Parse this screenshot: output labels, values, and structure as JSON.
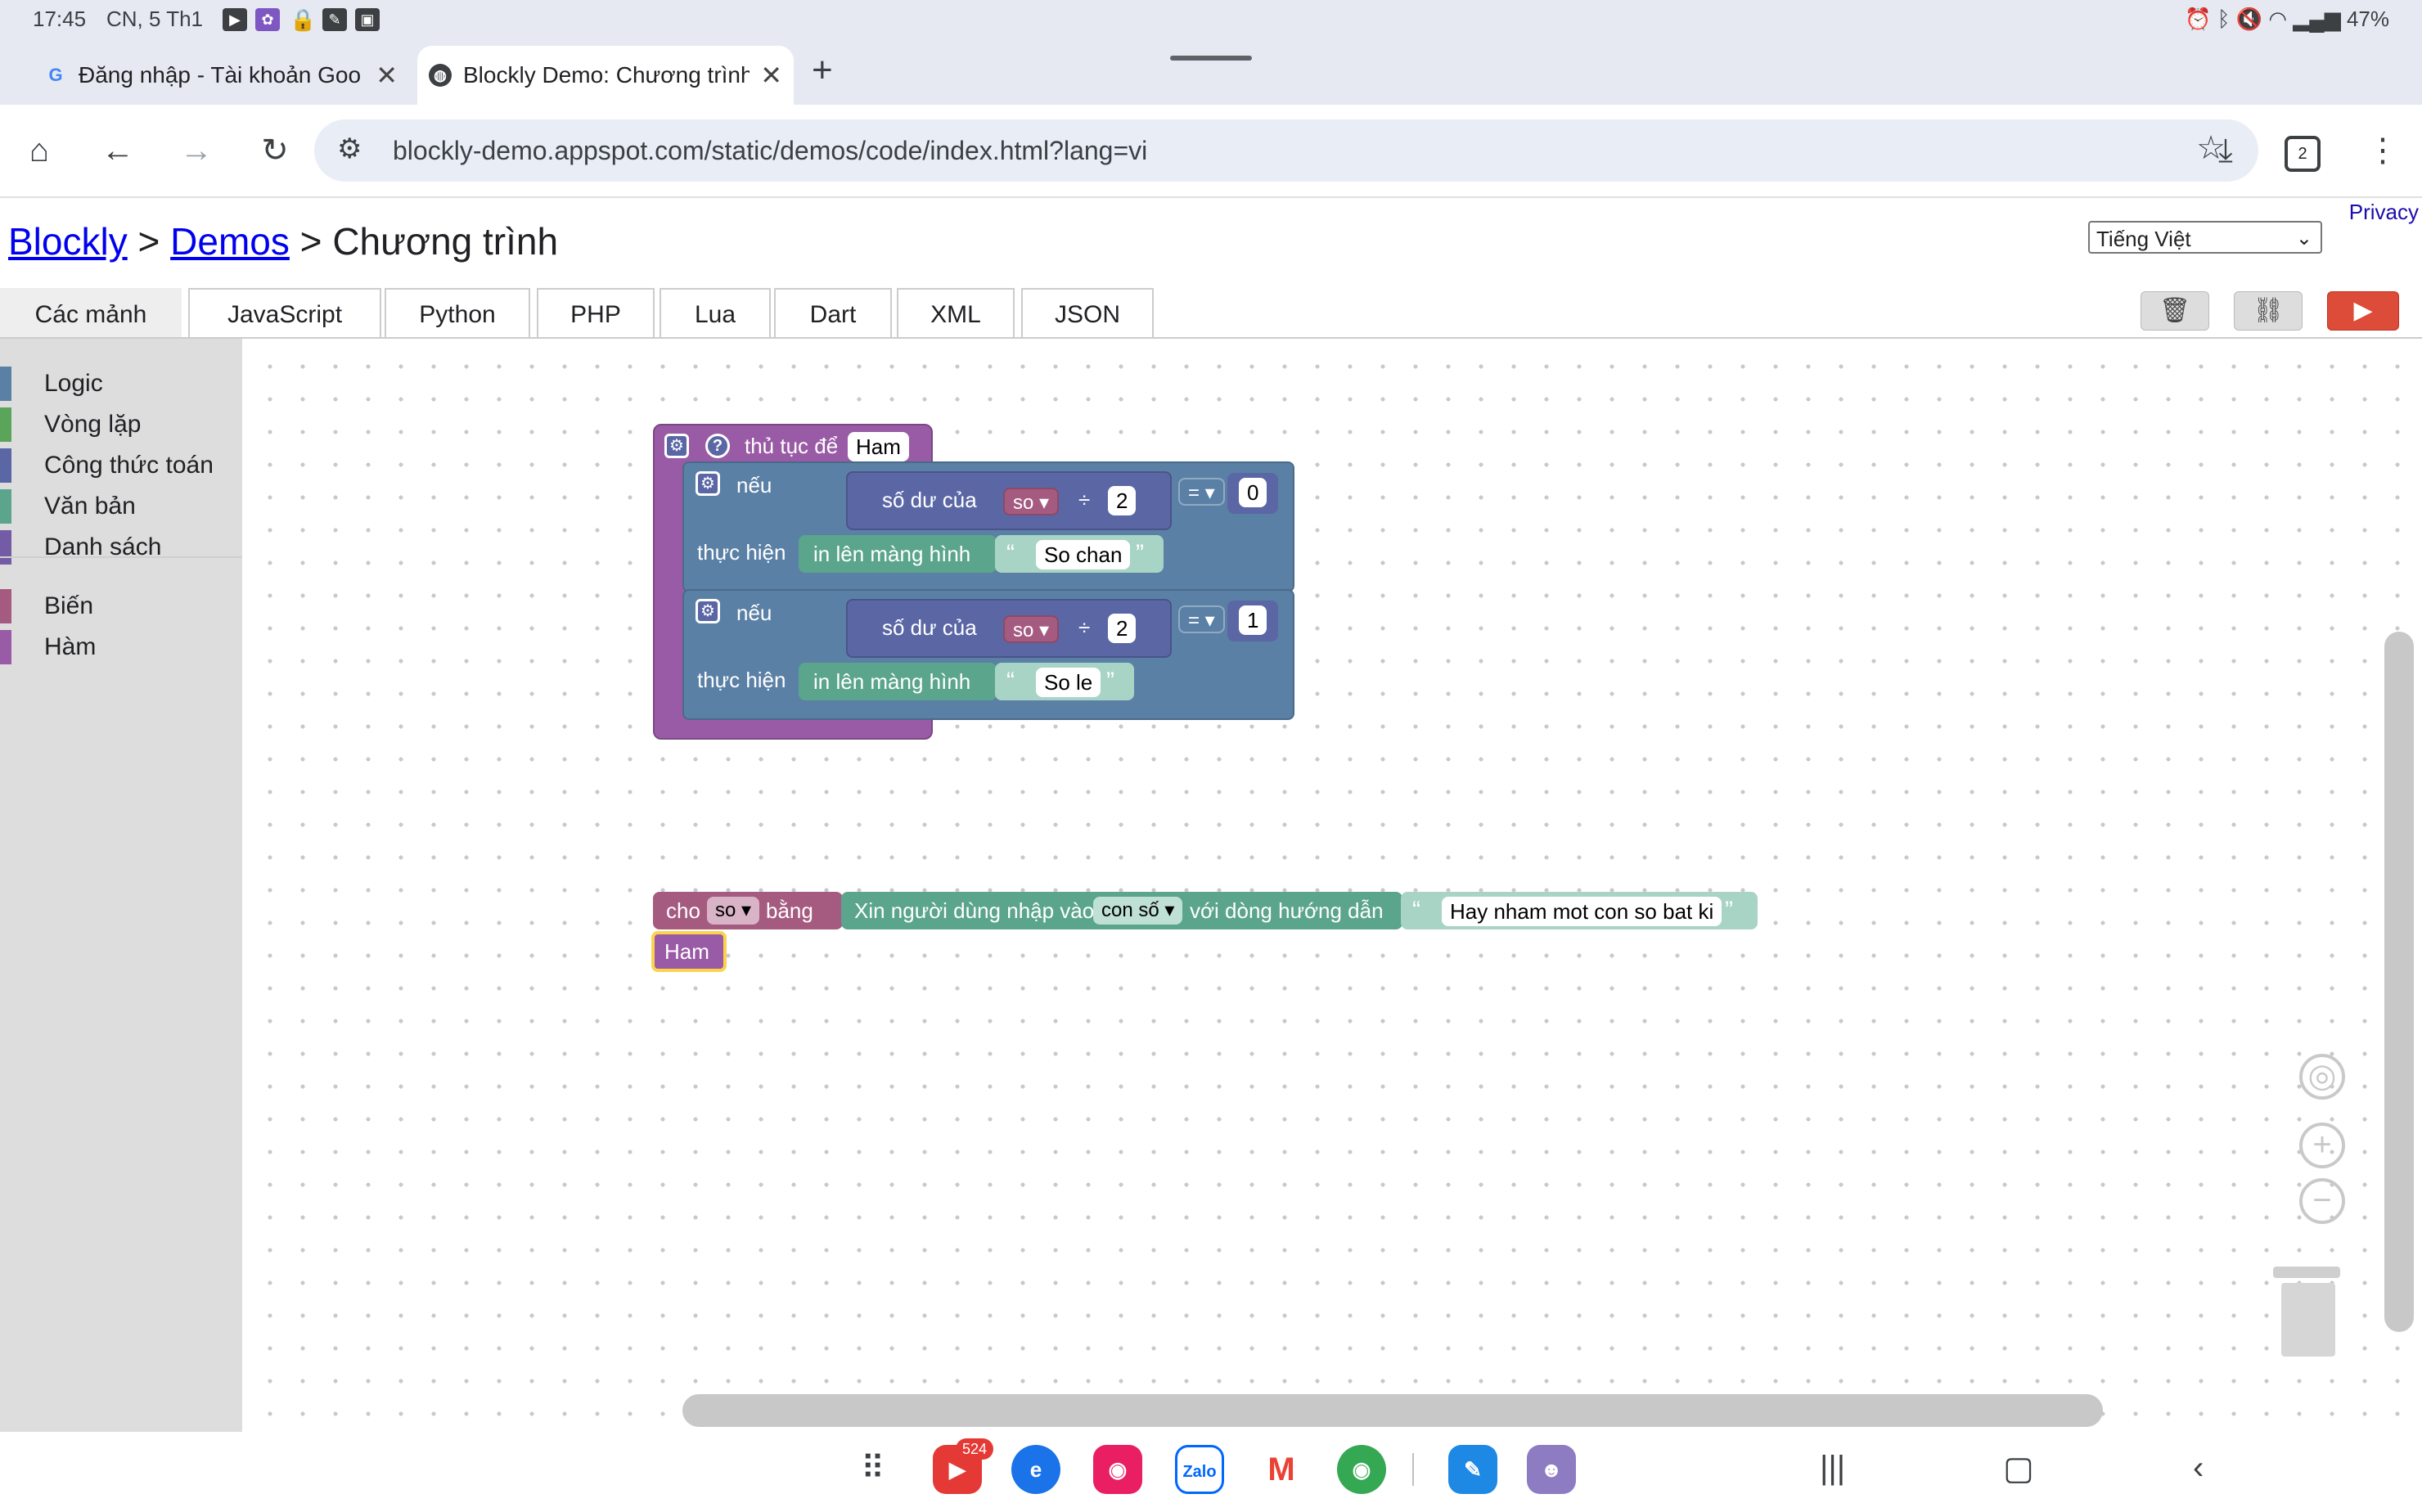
{
  "status_bar": {
    "time": "17:45",
    "date": "CN, 5 Th1",
    "battery": "47%"
  },
  "tabs": [
    {
      "title": "Đăng nhập - Tài khoản Goo",
      "favicon": "G"
    },
    {
      "title": "Blockly Demo: Chương trình",
      "favicon": "globe"
    }
  ],
  "toolbar": {
    "url": "blockly-demo.appspot.com/static/demos/code/index.html?lang=vi",
    "tab_count": "2"
  },
  "page": {
    "privacy": "Privacy",
    "breadcrumb": {
      "blockly": "Blockly",
      "sep": ">",
      "demos": "Demos",
      "current": "Chương trình"
    },
    "language": "Tiếng Việt",
    "tabs": [
      "Các mảnh",
      "JavaScript",
      "Python",
      "PHP",
      "Lua",
      "Dart",
      "XML",
      "JSON"
    ]
  },
  "toolbox": {
    "categories": [
      {
        "label": "Logic",
        "color": "#5b80a5"
      },
      {
        "label": "Vòng lặp",
        "color": "#5ba55b"
      },
      {
        "label": "Công thức toán",
        "color": "#5b67a5"
      },
      {
        "label": "Văn bản",
        "color": "#5ba58c"
      },
      {
        "label": "Danh sách",
        "color": "#745ba5"
      },
      {
        "label": "Biến",
        "color": "#a55b80"
      },
      {
        "label": "Hàm",
        "color": "#995ba5"
      }
    ]
  },
  "blocks": {
    "procedure": {
      "label": "thủ tục để",
      "name": "Ham"
    },
    "if1": {
      "if_label": "nếu",
      "mod_label": "số dư của",
      "var": "so",
      "div": "÷",
      "divisor": "2",
      "op": "=",
      "compare": "0",
      "do_label": "thực hiện",
      "print_label": "in lên màng hình",
      "text": "So chan"
    },
    "if2": {
      "if_label": "nếu",
      "mod_label": "số dư của",
      "var": "so",
      "div": "÷",
      "divisor": "2",
      "op": "=",
      "compare": "1",
      "do_label": "thực hiện",
      "print_label": "in lên màng hình",
      "text": "So le"
    },
    "set": {
      "cho": "cho",
      "var": "so",
      "bang": "bằng",
      "prompt": "Xin người dùng nhập vào",
      "type": "con số",
      "with": "với dòng hướng dẫn",
      "message": "Hay nham mot con so bat ki"
    },
    "call": {
      "name": "Ham"
    }
  },
  "colors": {
    "procedure": "#995ba5",
    "logic": "#5b80a5",
    "math": "#5b67a5",
    "text": "#5ba58c",
    "variable": "#a55b80",
    "run": "#dd4b39"
  },
  "nav": {
    "youtube_badge": "524",
    "zalo": "Zalo"
  }
}
